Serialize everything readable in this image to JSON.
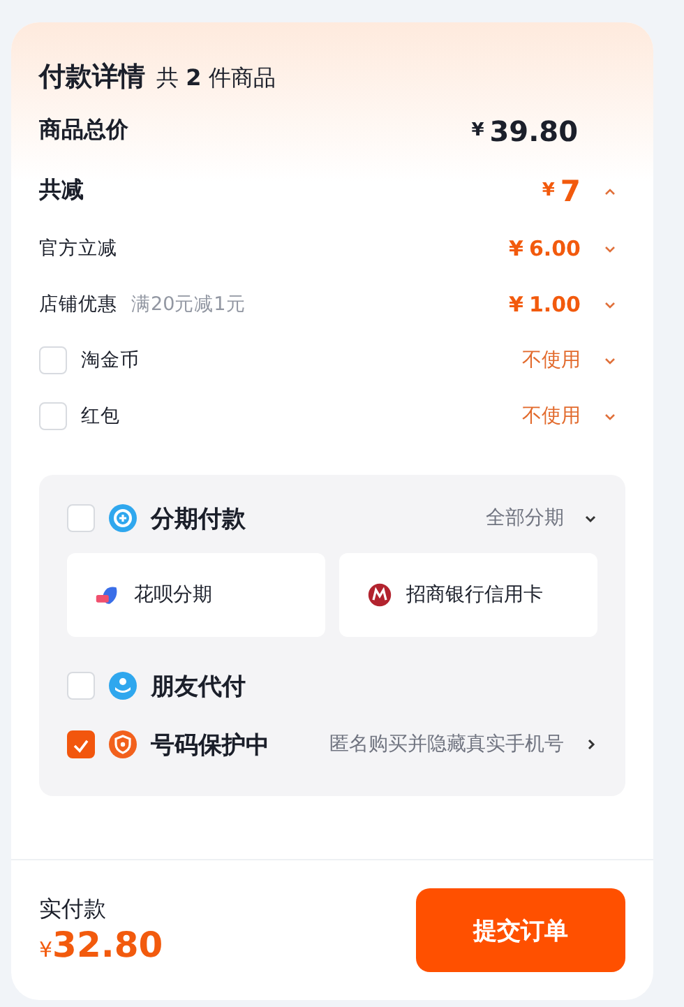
{
  "header": {
    "title": "付款详情",
    "count_text": "共 **2** 件商品"
  },
  "total": {
    "label": "商品总价",
    "currency": "¥",
    "amount": "39.80"
  },
  "discount": {
    "label": "共减",
    "currency": "¥",
    "amount": "7",
    "expanded": true
  },
  "discount_items": [
    {
      "kind": "amount",
      "label": "官方立减",
      "currency": "¥",
      "amount": "6.00"
    },
    {
      "kind": "amount",
      "label": "店铺优惠",
      "note": "满20元减1元",
      "currency": "¥",
      "amount": "1.00"
    },
    {
      "kind": "option",
      "label": "淘金币",
      "checked": false,
      "value": "不使用"
    },
    {
      "kind": "option",
      "label": "红包",
      "checked": false,
      "value": "不使用"
    }
  ],
  "installment": {
    "label": "分期付款",
    "checked": false,
    "action": "全部分期",
    "plans": [
      {
        "kind": "huabei",
        "label": "花呗分期"
      },
      {
        "kind": "bank",
        "label": "招商银行信用卡"
      }
    ]
  },
  "friend_pay": {
    "label": "朋友代付",
    "checked": false
  },
  "number_protection": {
    "label": "号码保护中",
    "checked": true,
    "description": "匿名购买并隐藏真实手机号"
  },
  "footer": {
    "label": "实付款",
    "currency": "¥",
    "amount": "32.80",
    "submit": "提交订单"
  }
}
